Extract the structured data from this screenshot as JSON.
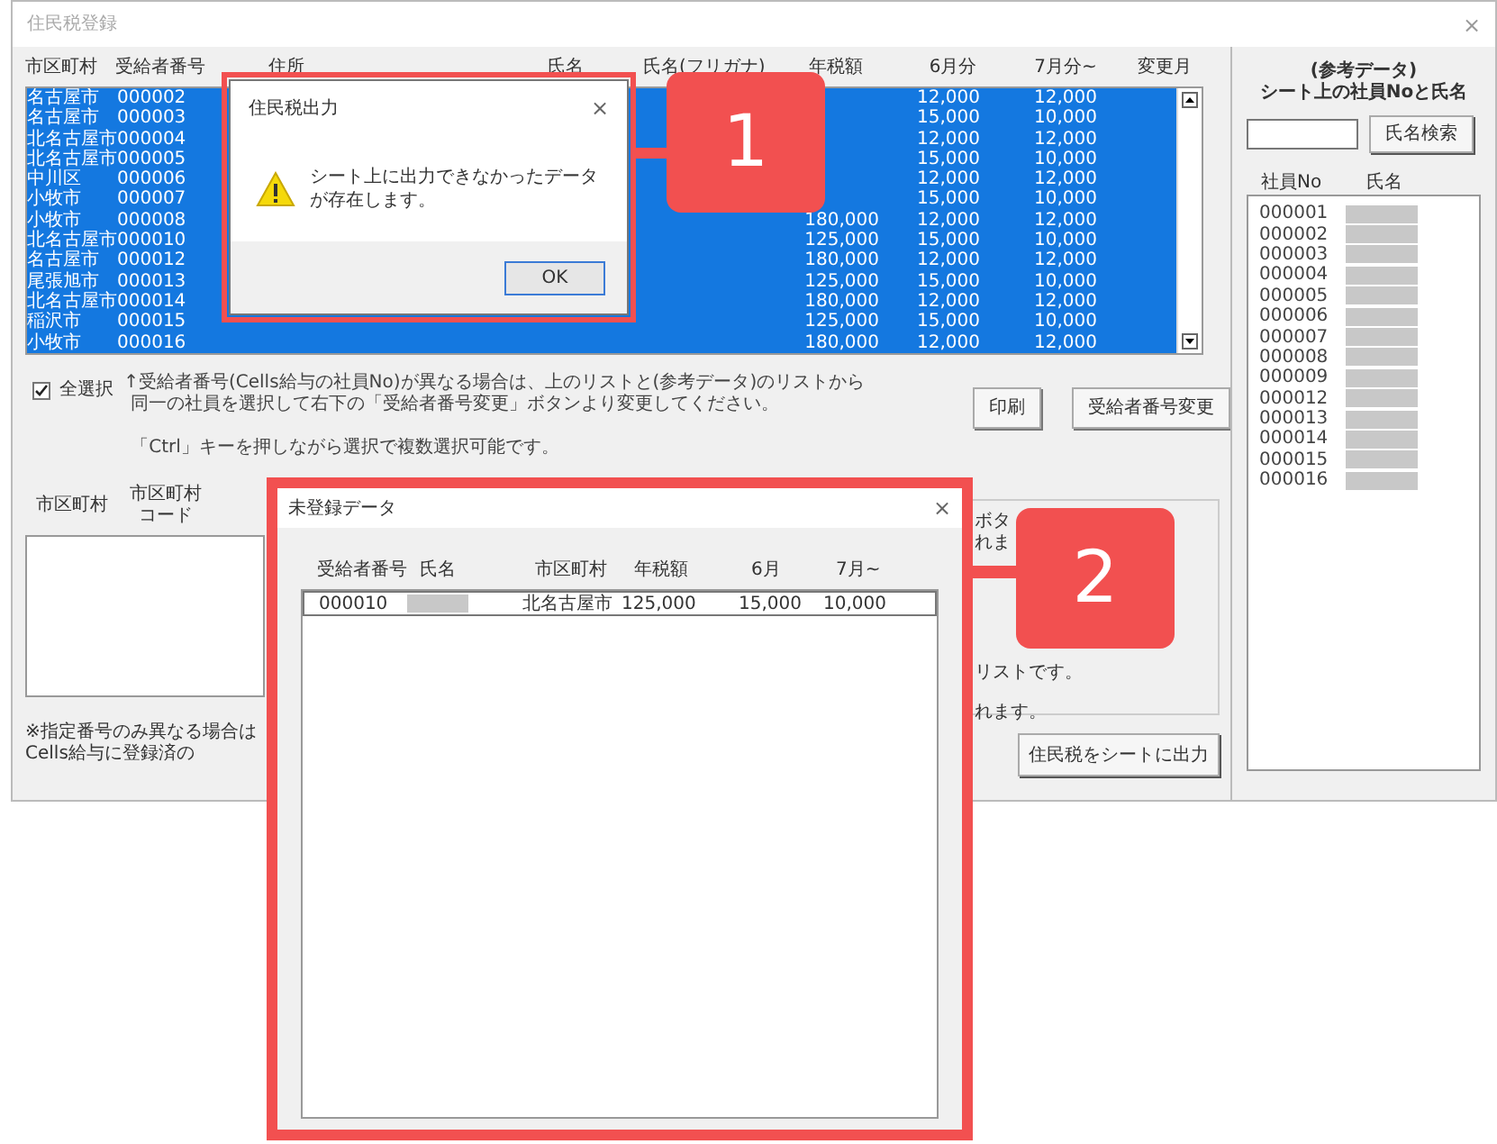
{
  "window": {
    "title": "住民税登録",
    "close": "×"
  },
  "main_table": {
    "columns": [
      "市区町村",
      "受給者番号",
      "住所",
      "氏名",
      "氏名(フリガナ)",
      "年税額",
      "6月分",
      "7月分~",
      "変更月"
    ],
    "rows": [
      {
        "city": "名古屋市",
        "number": "000002",
        "june": "12,000",
        "july": "12,000",
        "selected": true
      },
      {
        "city": "名古屋市",
        "number": "000003",
        "june": "15,000",
        "july": "10,000",
        "selected": true
      },
      {
        "city": "北名古屋市",
        "number": "000004",
        "june": "12,000",
        "july": "12,000",
        "selected": true
      },
      {
        "city": "北名古屋市",
        "number": "000005",
        "june": "15,000",
        "july": "10,000",
        "selected": true
      },
      {
        "city": "中川区",
        "number": "000006",
        "june": "12,000",
        "july": "12,000",
        "selected": true
      },
      {
        "city": "小牧市",
        "number": "000007",
        "june": "15,000",
        "july": "10,000",
        "selected": true
      },
      {
        "city": "小牧市",
        "number": "000008",
        "annual": "180,000",
        "june": "12,000",
        "july": "12,000",
        "selected": true
      },
      {
        "city": "北名古屋市",
        "number": "000010",
        "annual": "125,000",
        "june": "15,000",
        "july": "10,000",
        "selected": true
      },
      {
        "city": "名古屋市",
        "number": "000012",
        "annual": "180,000",
        "june": "12,000",
        "july": "12,000",
        "selected": true
      },
      {
        "city": "尾張旭市",
        "number": "000013",
        "annual": "125,000",
        "june": "15,000",
        "july": "10,000",
        "selected": true
      },
      {
        "city": "北名古屋市",
        "number": "000014",
        "annual": "180,000",
        "june": "12,000",
        "july": "12,000",
        "selected": true
      },
      {
        "city": "稲沢市",
        "number": "000015",
        "annual": "125,000",
        "june": "15,000",
        "july": "10,000",
        "selected": true
      },
      {
        "city": "小牧市",
        "number": "000016",
        "annual": "180,000",
        "june": "12,000",
        "july": "12,000",
        "selected": true
      }
    ]
  },
  "select_all": {
    "label": "全選択",
    "checked": true
  },
  "notes": [
    "↑受給者番号(Cells給与の社員No)が異なる場合は、上のリストと(参考データ)のリストから",
    "同一の社員を選択して右下の「受給者番号変更」ボタンより変更してください。",
    "「Ctrl」キーを押しながら選択で複数選択可能です。"
  ],
  "buttons": [
    "印刷",
    "受給者番号変更"
  ],
  "lower_section": {
    "columns": [
      "市区町村",
      "市区町村コード"
    ],
    "notes": [
      "※指定番号のみ異なる場合は",
      "Cells給与に登録済の"
    ],
    "group_texts": [
      "ボタ",
      "れま",
      "リストです。",
      "れます。"
    ],
    "output_button": "住民税をシートに出力"
  },
  "reference_panel": {
    "title_lines": [
      "(参考データ)",
      "シート上の社員Noと氏名"
    ],
    "search_button": "氏名検索",
    "columns": [
      "社員No",
      "氏名"
    ],
    "employees": [
      "000001",
      "000002",
      "000003",
      "000004",
      "000005",
      "000006",
      "000007",
      "000008",
      "000009",
      "000012",
      "000013",
      "000014",
      "000015",
      "000016"
    ]
  },
  "dialog_output": {
    "title": "住民税出力",
    "close": "×",
    "message": "シート上に出力できなかったデータが存在します。",
    "ok": "OK"
  },
  "dialog_unregistered": {
    "title": "未登録データ",
    "close": "×",
    "columns": [
      "受給者番号",
      "氏名",
      "市区町村",
      "年税額",
      "6月",
      "7月~"
    ],
    "rows": [
      {
        "number": "000010",
        "city": "北名古屋市",
        "annual": "125,000",
        "june": "15,000",
        "july": "10,000",
        "selected": true
      }
    ]
  },
  "callouts": [
    "1",
    "2"
  ]
}
